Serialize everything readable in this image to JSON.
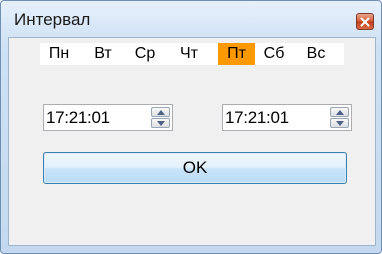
{
  "window": {
    "title": "Интервал",
    "close_icon": "close-icon"
  },
  "days": {
    "items": [
      {
        "label": "Пн",
        "active": false
      },
      {
        "label": "Вт",
        "active": false
      },
      {
        "label": "Ср",
        "active": false
      },
      {
        "label": "Чт",
        "active": false
      },
      {
        "label": "Пт",
        "active": true
      },
      {
        "label": "Сб",
        "active": false
      },
      {
        "label": "Вс",
        "active": false
      }
    ],
    "active_color": "#ff9900"
  },
  "time_from": {
    "value": "17:21:01"
  },
  "time_to": {
    "value": "17:21:01"
  },
  "ok_button": {
    "label": "OK"
  }
}
